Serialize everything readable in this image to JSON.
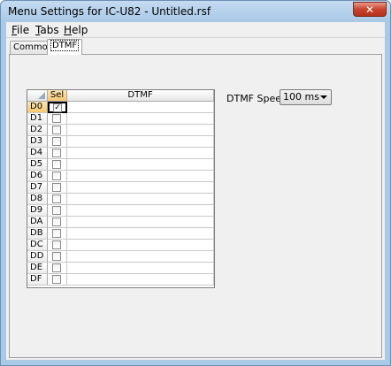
{
  "window": {
    "title": "Menu Settings for IC-U82 - Untitled.rsf",
    "close_glyph": "✕"
  },
  "menu": [
    {
      "first": "F",
      "rest": "ile"
    },
    {
      "first": "T",
      "rest": "abs"
    },
    {
      "first": "H",
      "rest": "elp"
    }
  ],
  "tabs": [
    {
      "label": "Common",
      "active": false
    },
    {
      "label": "DTMF",
      "active": true
    }
  ],
  "grid": {
    "headers": {
      "sel": "Sel",
      "dtmf": "DTMF"
    },
    "rows": [
      {
        "label": "D0",
        "checked": true,
        "value": ""
      },
      {
        "label": "D1",
        "checked": false,
        "value": ""
      },
      {
        "label": "D2",
        "checked": false,
        "value": ""
      },
      {
        "label": "D3",
        "checked": false,
        "value": ""
      },
      {
        "label": "D4",
        "checked": false,
        "value": ""
      },
      {
        "label": "D5",
        "checked": false,
        "value": ""
      },
      {
        "label": "D6",
        "checked": false,
        "value": ""
      },
      {
        "label": "D7",
        "checked": false,
        "value": ""
      },
      {
        "label": "D8",
        "checked": false,
        "value": ""
      },
      {
        "label": "D9",
        "checked": false,
        "value": ""
      },
      {
        "label": "DA",
        "checked": false,
        "value": ""
      },
      {
        "label": "DB",
        "checked": false,
        "value": ""
      },
      {
        "label": "DC",
        "checked": false,
        "value": ""
      },
      {
        "label": "DD",
        "checked": false,
        "value": ""
      },
      {
        "label": "DE",
        "checked": false,
        "value": ""
      },
      {
        "label": "DF",
        "checked": false,
        "value": ""
      }
    ]
  },
  "dtmf_speed": {
    "label": "DTMF Speed",
    "value": "100 ms"
  }
}
